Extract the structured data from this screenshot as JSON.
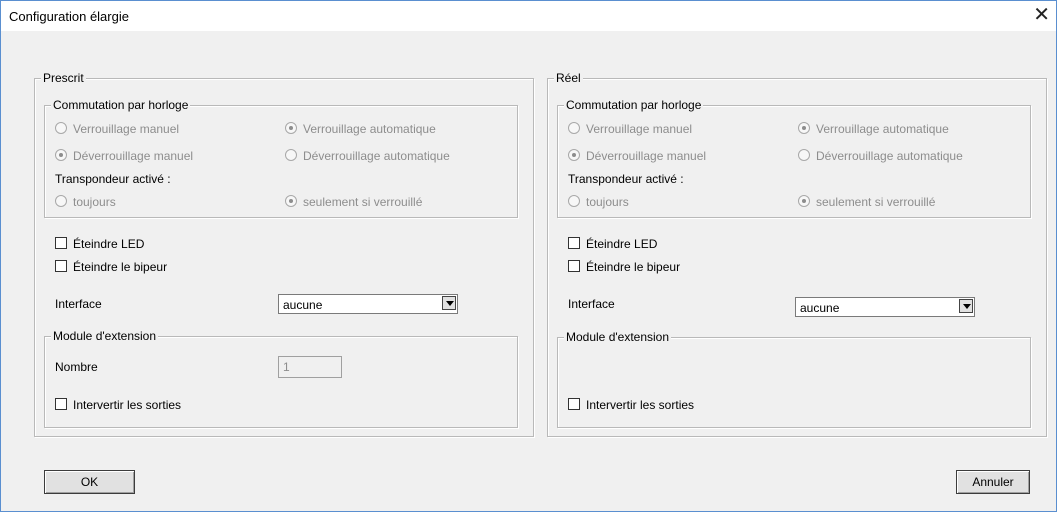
{
  "window": {
    "title": "Configuration élargie",
    "close_glyph": "✕"
  },
  "prescrit": {
    "legend": "Prescrit",
    "commutation": {
      "legend": "Commutation par horloge",
      "verrouillage_manuel": "Verrouillage manuel",
      "verrouillage_auto": "Verrouillage automatique",
      "deverrouillage_manuel": "Déverrouillage manuel",
      "deverrouillage_auto": "Déverrouillage automatique",
      "transpondeur_label": "Transpondeur activé :",
      "toujours": "toujours",
      "seulement": "seulement si verrouillé"
    },
    "eteindre_led": "Éteindre LED",
    "eteindre_bipeur": "Éteindre le bipeur",
    "interface_label": "Interface",
    "interface_value": "aucune",
    "module": {
      "legend": "Module d'extension",
      "nombre_label": "Nombre",
      "nombre_value": "1",
      "intervertir": "Intervertir les sorties"
    }
  },
  "reel": {
    "legend": "Réel",
    "commutation": {
      "legend": "Commutation par horloge",
      "verrouillage_manuel": "Verrouillage manuel",
      "verrouillage_auto": "Verrouillage automatique",
      "deverrouillage_manuel": "Déverrouillage manuel",
      "deverrouillage_auto": "Déverrouillage automatique",
      "transpondeur_label": "Transpondeur activé :",
      "toujours": "toujours",
      "seulement": "seulement si verrouillé"
    },
    "eteindre_led": "Éteindre LED",
    "eteindre_bipeur": "Éteindre le bipeur",
    "interface_label": "Interface",
    "interface_value": "aucune",
    "module": {
      "legend": "Module d'extension",
      "intervertir": "Intervertir les sorties"
    }
  },
  "buttons": {
    "ok": "OK",
    "cancel": "Annuler"
  },
  "selected": {
    "prescrit_verrouillage": "automatique",
    "prescrit_deverrouillage": "manuel",
    "prescrit_transpondeur": "seulement si verrouillé",
    "reel_verrouillage": "automatique",
    "reel_deverrouillage": "manuel",
    "reel_transpondeur": "seulement si verrouillé"
  }
}
